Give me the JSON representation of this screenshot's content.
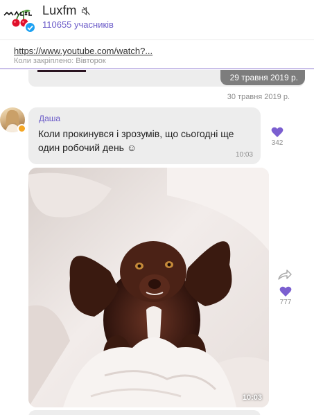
{
  "header": {
    "title": "Luxfm",
    "members": "110655 учасників",
    "logo_text": "Радіо Люкс",
    "icons": [
      "logo",
      "verified-icon",
      "mute-icon"
    ]
  },
  "pinned": {
    "link": "https://www.youtube.com/watch?...",
    "subtitle": "Коли закріплено: Вівторок"
  },
  "chat": {
    "prev_date_chip": "29 травня 2019 р.",
    "day_label": "30 травня 2019 р.",
    "message": {
      "sender": "Даша",
      "text": "Коли прокинувся і зрозумів, що сьогодні ще один робочий день ☺",
      "time": "10:03",
      "likes": "342"
    },
    "photo": {
      "time": "10:03",
      "likes": "777"
    }
  },
  "colors": {
    "accent": "#6a5ac8",
    "like": "#7b5fd0",
    "bubble": "#ededed",
    "date_chip": "#7d7d7d",
    "verified": "#1da1f2"
  }
}
